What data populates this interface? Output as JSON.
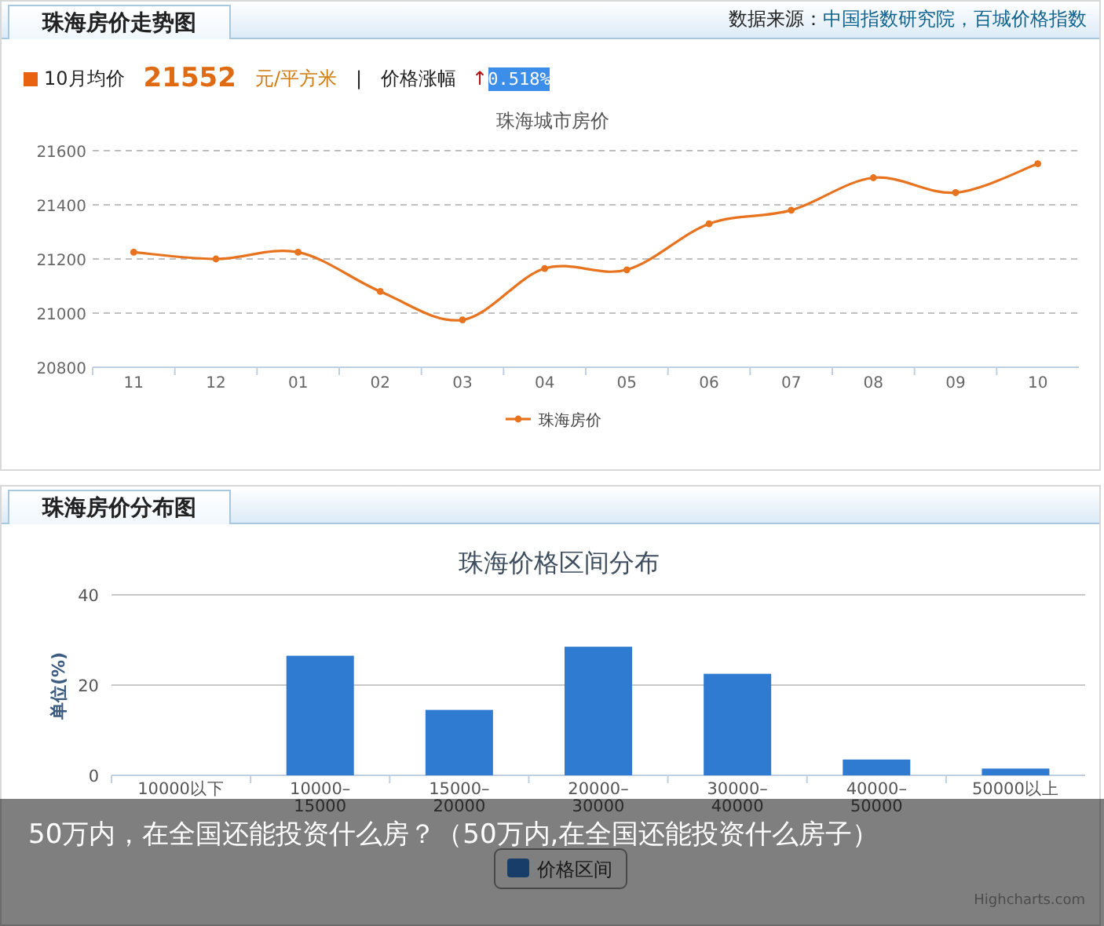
{
  "trend_panel": {
    "tab": "珠海房价走势图",
    "source_label": "数据来源：",
    "source_link": "中国指数研究院，百城价格指数",
    "summary": {
      "month_label": "10月均价",
      "price": "21552",
      "unit": "元/平方米",
      "separator": "|",
      "change_label": "价格涨幅",
      "arrow": "↑",
      "change": "0.518%"
    },
    "chart_data": {
      "type": "line",
      "title": "珠海城市房价",
      "categories": [
        "11",
        "12",
        "01",
        "02",
        "03",
        "04",
        "05",
        "06",
        "07",
        "08",
        "09",
        "10"
      ],
      "series": [
        {
          "name": "珠海房价",
          "color": "#e8731f",
          "marker": true,
          "values": [
            21225,
            21200,
            21225,
            21080,
            20975,
            21165,
            21160,
            21330,
            21380,
            21500,
            21445,
            21552
          ]
        }
      ],
      "grid": true,
      "ylim": [
        20800,
        21600
      ],
      "yticks": [
        20800,
        21000,
        21200,
        21400,
        21600
      ]
    }
  },
  "distribution_panel": {
    "tab": "珠海房价分布图",
    "chart_data": {
      "type": "bar",
      "title": "珠海价格区间分布",
      "ylabel": "单位(%)",
      "categories": [
        "10000以下",
        "10000–15000",
        "15000–20000",
        "20000–30000",
        "30000–40000",
        "40000–50000",
        "50000以上"
      ],
      "series": [
        {
          "name": "价格区间",
          "color": "#2e7bd1",
          "values": [
            0,
            26.5,
            14.5,
            28.5,
            22.5,
            3.5,
            1.5
          ]
        }
      ],
      "grid": true,
      "ylim": [
        0,
        40
      ],
      "yticks": [
        0,
        20,
        40
      ]
    },
    "credit": "Highcharts.com"
  },
  "caption": "50万内，在全国还能投资什么房？（50万内,在全国还能投资什么房子）"
}
